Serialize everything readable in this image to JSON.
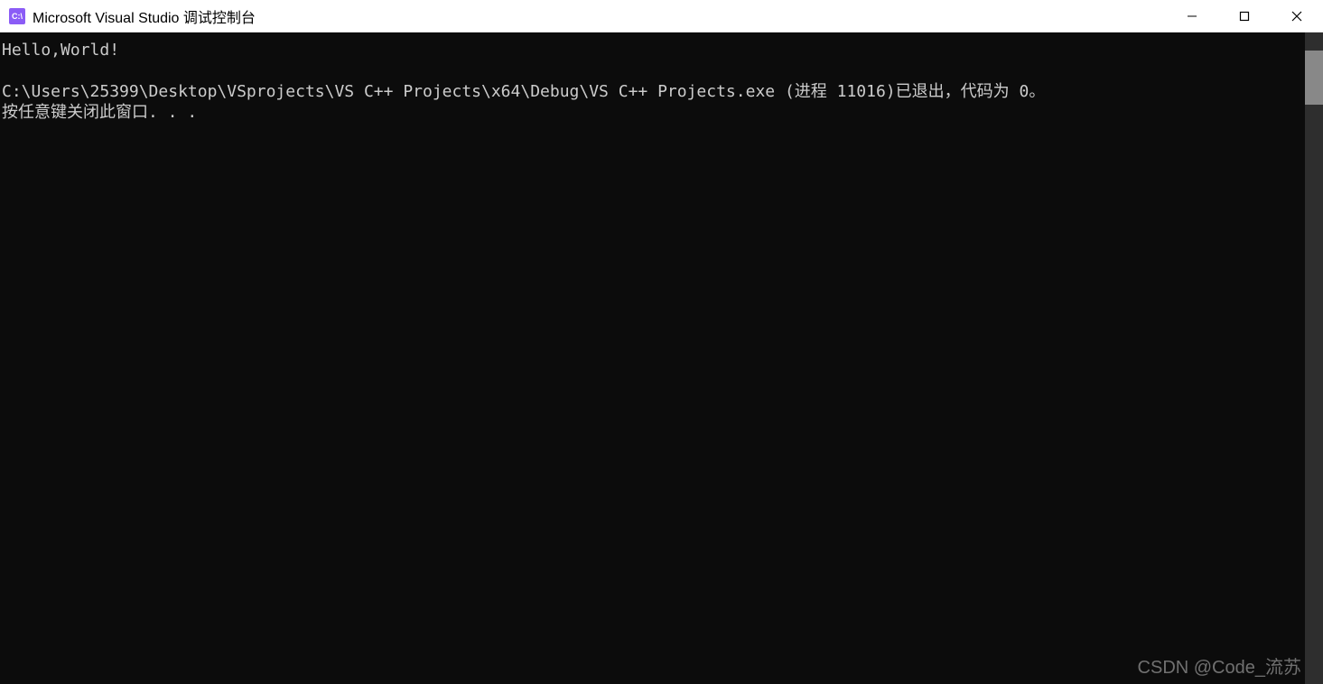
{
  "titlebar": {
    "icon_label": "C:\\",
    "title": "Microsoft Visual Studio 调试控制台"
  },
  "console": {
    "line1": "Hello,World!",
    "line2": "",
    "line3": "C:\\Users\\25399\\Desktop\\VSprojects\\VS C++ Projects\\x64\\Debug\\VS C++ Projects.exe (进程 11016)已退出，代码为 0。",
    "line4": "按任意键关闭此窗口. . ."
  },
  "watermark": "CSDN @Code_流苏"
}
